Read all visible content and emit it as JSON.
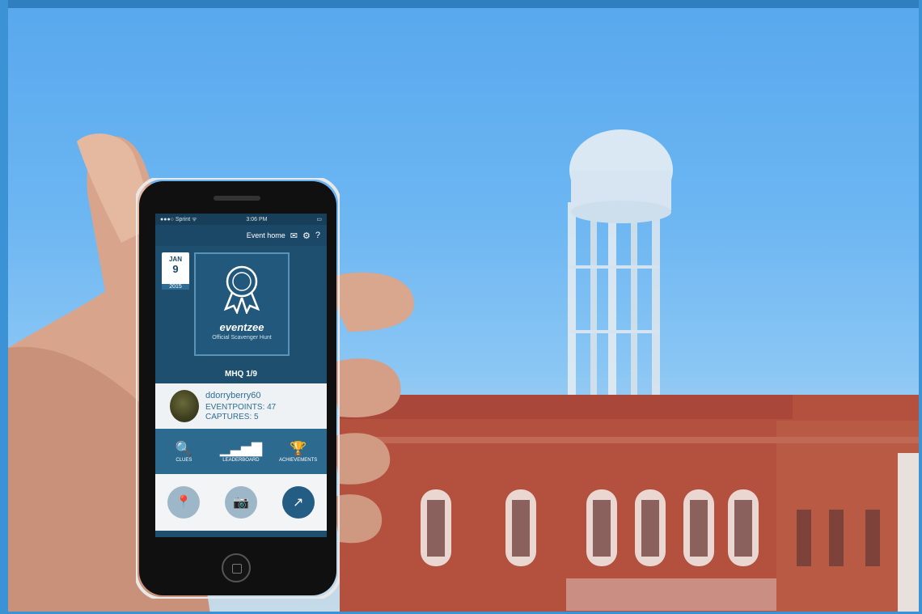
{
  "phone": {
    "status": {
      "carrier": "●●●○ Sprint ᯤ",
      "time": "3:06 PM",
      "battery": "▭"
    },
    "nav": {
      "title": "Event home",
      "icons": [
        "mail-icon",
        "gear-icon",
        "help-icon"
      ],
      "mail_glyph": "✉",
      "gear_glyph": "⚙",
      "help_glyph": "?"
    },
    "date": {
      "month": "JAN",
      "day": "9",
      "year": "2015"
    },
    "event": {
      "logo_name": "eventzee",
      "logo_sub": "Official Scavenger Hunt"
    },
    "event_title": "MHQ 1/9",
    "user": {
      "name": "ddorryberry60",
      "points": "EVENTPOINTS: 47",
      "captures": "CAPTURES: 5"
    },
    "tabs": [
      {
        "label": "CLUES",
        "icon": "search-icon",
        "glyph": "🔍"
      },
      {
        "label": "LEADERBOARD",
        "icon": "bar-chart-icon",
        "glyph": "▁▃▅▇"
      },
      {
        "label": "ACHIEVEMENTS",
        "icon": "trophy-icon",
        "glyph": "🏆"
      }
    ],
    "actions": [
      {
        "icon": "map-pin-icon",
        "glyph": "📍"
      },
      {
        "icon": "camera-icon",
        "glyph": "📷"
      },
      {
        "icon": "share-icon",
        "glyph": "↗"
      }
    ]
  },
  "colors": {
    "sky": "#6cb6f2",
    "brick": "#b4503e",
    "app_primary": "#1e4f6e",
    "border": "#3b93d6"
  }
}
